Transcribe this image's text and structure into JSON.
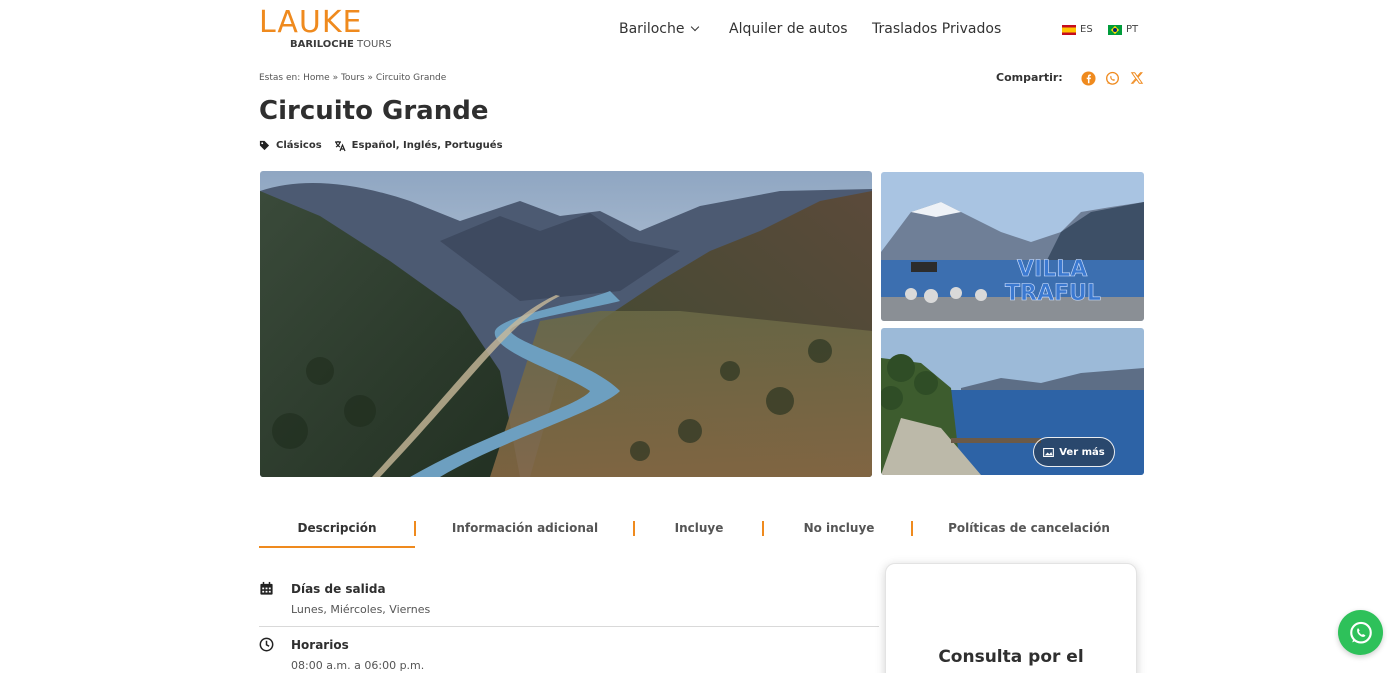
{
  "brand": {
    "logo_word": "LAUKE",
    "logo_sub_bold": "BARILOCHE",
    "logo_sub_light": "TOURS"
  },
  "nav": {
    "items": [
      {
        "label": "Bariloche",
        "has_dropdown": true
      },
      {
        "label": "Alquiler de autos"
      },
      {
        "label": "Traslados Privados"
      }
    ],
    "languages": [
      {
        "code": "ES",
        "flag": "spain-flag-icon"
      },
      {
        "code": "PT",
        "flag": "brazil-flag-icon"
      }
    ]
  },
  "breadcrumb": {
    "prefix": "Estas en:",
    "items": [
      "Home",
      "Tours",
      "Circuito Grande"
    ],
    "separator": "»"
  },
  "share": {
    "label": "Compartir:",
    "icons": [
      "facebook-icon",
      "whatsapp-icon",
      "x-icon"
    ]
  },
  "tour": {
    "title": "Circuito Grande",
    "category": "Clásicos",
    "languages": "Español, Inglés, Portugués"
  },
  "gallery": {
    "more_label": "Ver más",
    "side_image_sign": "VILLA TRAFUL"
  },
  "tabs": [
    {
      "label": "Descripción",
      "active": true
    },
    {
      "label": "Información adicional"
    },
    {
      "label": "Incluye"
    },
    {
      "label": "No incluye"
    },
    {
      "label": "Políticas de cancelación"
    }
  ],
  "details": [
    {
      "icon": "calendar-icon",
      "heading": "Días de salida",
      "text": "Lunes, Miércoles, Viernes"
    },
    {
      "icon": "clock-icon",
      "heading": "Horarios",
      "text": "08:00 a.m. a 06:00 p.m."
    }
  ],
  "consulta": {
    "text": "Consulta por el"
  },
  "colors": {
    "accent": "#ef8a1e",
    "whatsapp": "#2ec15a",
    "text": "#2f2f2f"
  }
}
